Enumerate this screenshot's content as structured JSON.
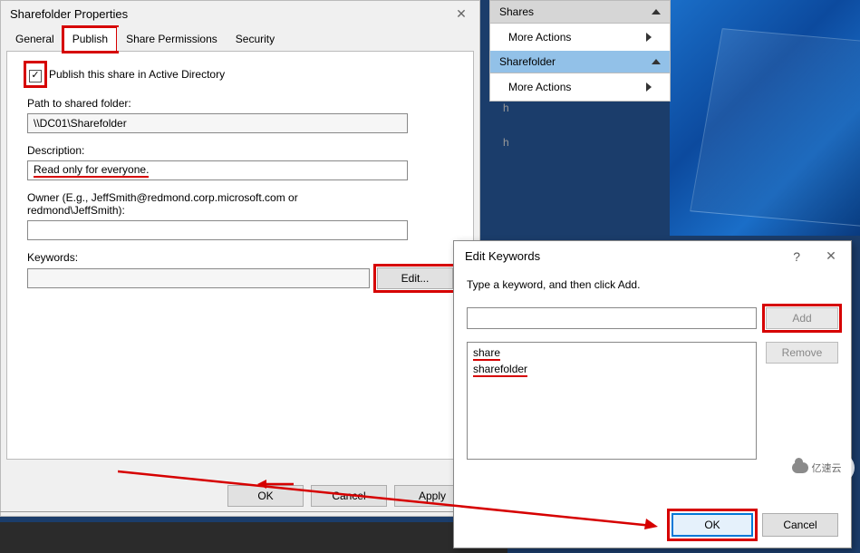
{
  "props": {
    "title": "Sharefolder Properties",
    "tabs": {
      "general": "General",
      "publish": "Publish",
      "share_permissions": "Share Permissions",
      "security": "Security"
    },
    "publish_checkbox": "Publish this share in Active Directory",
    "path_label": "Path to shared folder:",
    "path_value": "\\\\DC01\\Sharefolder",
    "desc_label": "Description:",
    "desc_value": "Read only for everyone.",
    "owner_label": "Owner (E.g., JeffSmith@redmond.corp.microsoft.com or redmond\\JeffSmith):",
    "owner_value": "",
    "keywords_label": "Keywords:",
    "keywords_value": "",
    "edit_btn": "Edit...",
    "ok": "OK",
    "cancel": "Cancel",
    "apply": "Apply"
  },
  "keywords_dialog": {
    "title": "Edit Keywords",
    "prompt": "Type a keyword, and then click Add.",
    "add": "Add",
    "remove": "Remove",
    "list": [
      "share",
      "sharefolder"
    ],
    "ok": "OK",
    "cancel": "Cancel"
  },
  "side": {
    "shares": "Shares",
    "more_actions": "More Actions",
    "sharefolder": "Sharefolder"
  },
  "ghost1": "h",
  "ghost2": "h",
  "watermark": "亿速云"
}
